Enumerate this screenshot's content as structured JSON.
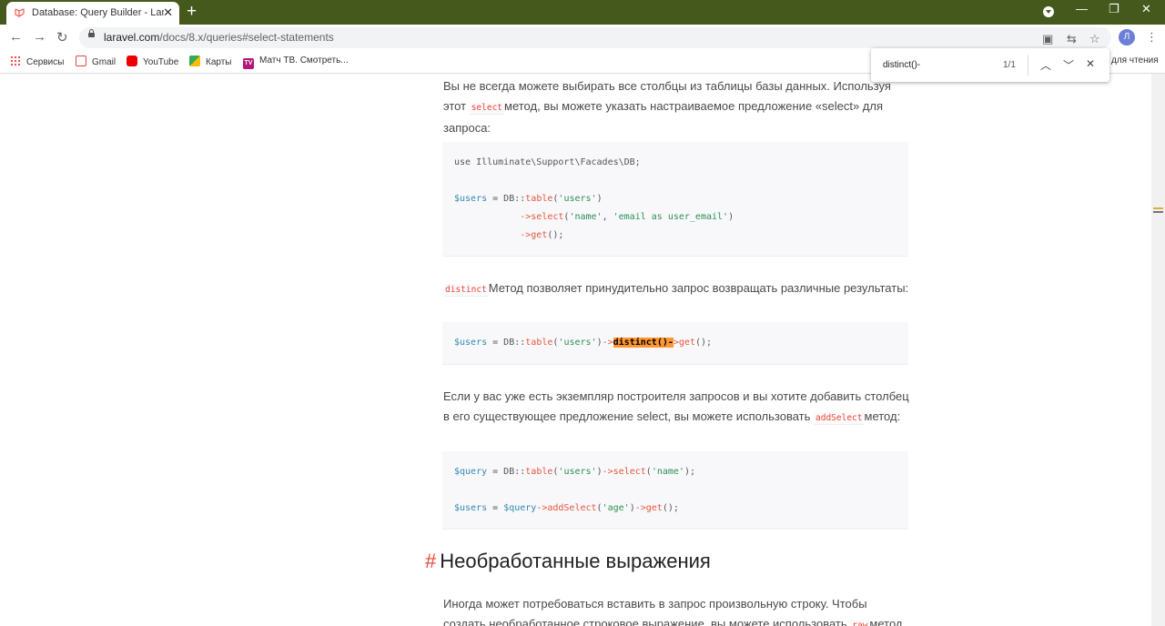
{
  "browser": {
    "tab_title": "Database: Query Builder - Larave",
    "tab_close": "✕",
    "new_tab": "+",
    "url_host": "laravel.com",
    "url_path": "/docs/8.x/queries#select-statements",
    "profile_initial": "Л"
  },
  "bookmarks": [
    {
      "label": "Сервисы",
      "icon": "apps-icon"
    },
    {
      "label": "Gmail",
      "icon": "gmail-icon"
    },
    {
      "label": "YouTube",
      "icon": "youtube-icon"
    },
    {
      "label": "Карты",
      "icon": "maps-icon"
    },
    {
      "label": "Матч ТВ. Смотреть...",
      "icon": "tv-icon"
    }
  ],
  "reading_list": "для чтения",
  "find": {
    "query": "distinct()-",
    "count": "1/1"
  },
  "content": {
    "para1_a": "Вы не всегда можете выбирать все столбцы из таблицы базы данных. Используя этот",
    "para1_code": "select",
    "para1_b": "метод, вы можете указать настраиваемое предложение «select» для запроса:",
    "para2_code": "distinct",
    "para2_b": "Метод позволяет принудительно запрос возвращать различные результаты:",
    "para3_a": "Если у вас уже есть экземпляр построителя запросов и вы хотите добавить столбец в его существующее предложение select, вы можете использовать",
    "para3_code": "addSelect",
    "para3_b": "метод:",
    "heading_hash": "#",
    "heading": "Необработанные выражения",
    "para4_a": "Иногда может потребоваться вставить в запрос произвольную строку. Чтобы создать необработанное строковое выражение, вы можете использовать",
    "para4_code": "raw",
    "para4_b": "метод"
  },
  "colors": {
    "titlebar": "#45591c",
    "inline_code": "#eb4432",
    "find_highlight": "#ff9632",
    "variable": "#2f8ab0",
    "string": "#2d8f55"
  }
}
